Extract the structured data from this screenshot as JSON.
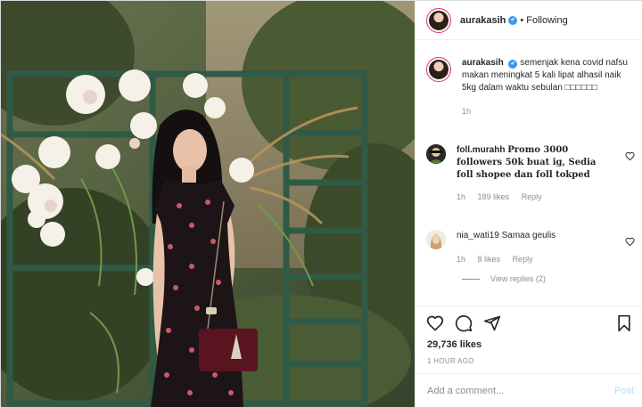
{
  "header": {
    "username": "aurakasih",
    "verified_glyph": "✔",
    "separator": "•",
    "follow_status": "Following"
  },
  "caption": {
    "username": "aurakasih",
    "text": "semenjak kena covid nafsu makan meningkat 5 kali lipat alhasil naik 5kg dalam waktu sebulan",
    "emoji": "□□□□□□",
    "age": "1h"
  },
  "comments": [
    {
      "username": "foll.murahh",
      "text": "Promo 3000 followers 50k buat ig, Sedia foll shopee dan foll tokped",
      "age": "1h",
      "likes": "189 likes",
      "reply_label": "Reply"
    },
    {
      "username": "nia_wati19",
      "text": "Samaa geulis",
      "age": "1h",
      "likes": "8 likes",
      "reply_label": "Reply"
    }
  ],
  "view_replies": "View replies (2)",
  "actions": {
    "icons": [
      "heart-icon",
      "comment-icon",
      "share-icon",
      "bookmark-icon"
    ],
    "likes": "29,736 likes",
    "timestamp": "1 HOUR AGO"
  },
  "add_comment": {
    "placeholder": "Add a comment...",
    "post_label": "Post"
  },
  "colors": {
    "verified": "#3897f0",
    "post_button_disabled": "#b2dffc",
    "secondary_text": "#8e8e8e"
  }
}
